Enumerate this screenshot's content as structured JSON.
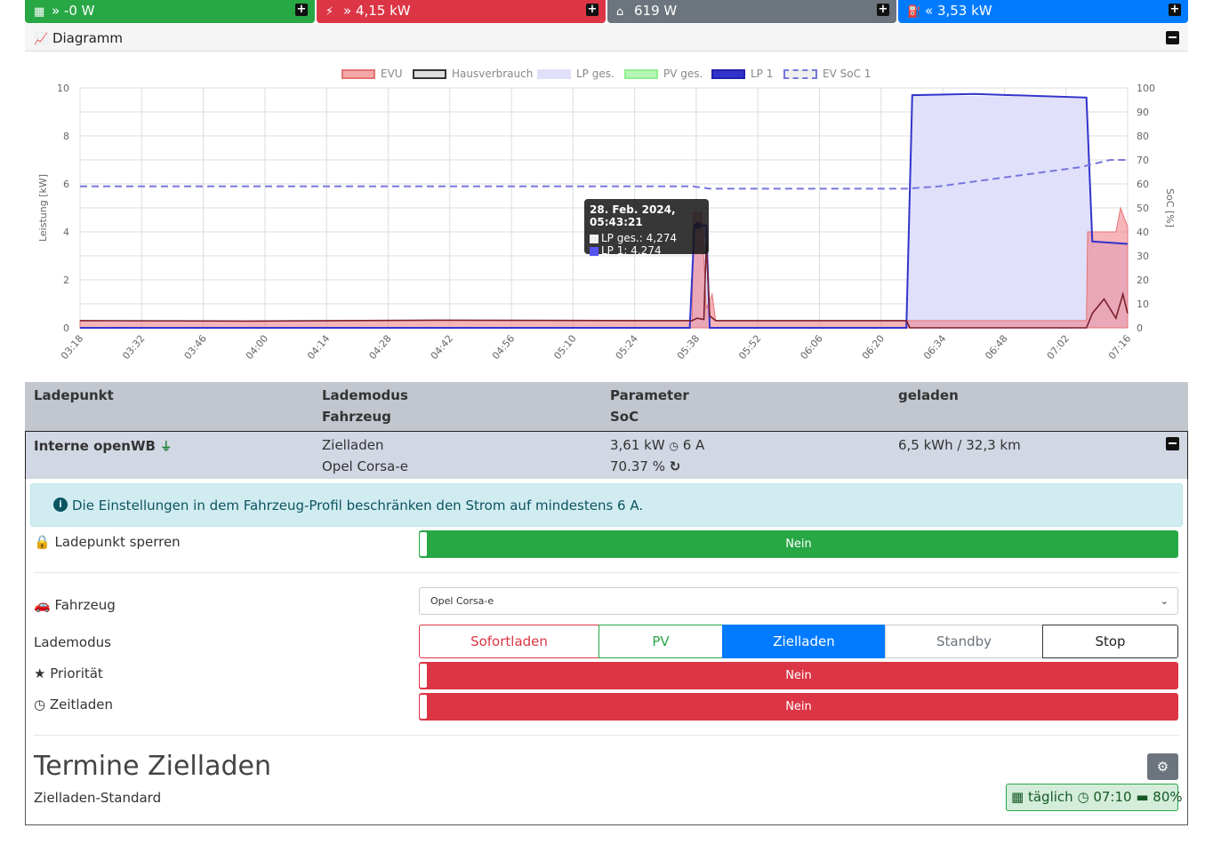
{
  "top_bar": [
    {
      "label": "-0 W",
      "color": "#28a745",
      "icon": "grid-meter-icon",
      "arrow": "»"
    },
    {
      "label": "4,15 kW",
      "color": "#dc3545",
      "icon": "power-tower-icon",
      "arrow": "»"
    },
    {
      "label": "619 W",
      "color": "#6c757d",
      "icon": "home-icon",
      "arrow": ""
    },
    {
      "label": "3,53 kW",
      "color": "#007bff",
      "icon": "charging-station-icon",
      "arrow": "«"
    }
  ],
  "diagram": {
    "title": "Diagramm"
  },
  "chart_data": {
    "type": "area",
    "legend": [
      "EVU",
      "Hausverbrauch",
      "LP ges.",
      "PV ges.",
      "LP 1",
      "EV SoC 1"
    ],
    "ylabel_left": "Leistung [kW]",
    "ylabel_right": "SoC [%]",
    "ylim_left": [
      0,
      10
    ],
    "ylim_right": [
      0,
      100
    ],
    "yticks_left": [
      "0",
      "2",
      "4",
      "6",
      "8",
      "10"
    ],
    "yticks_right": [
      "0",
      "10",
      "20",
      "30",
      "40",
      "50",
      "60",
      "70",
      "80",
      "90",
      "100"
    ],
    "xticks": [
      "03:18",
      "03:32",
      "03:46",
      "04:00",
      "04:14",
      "04:28",
      "04:42",
      "04:56",
      "05:10",
      "05:24",
      "05:38",
      "05:52",
      "06:06",
      "06:20",
      "06:34",
      "06:48",
      "07:02",
      "07:16"
    ],
    "series": [
      {
        "name": "EVU",
        "color": "#f4a6a8",
        "points": [
          [
            0,
            0.3
          ],
          [
            140,
            0.28
          ],
          [
            300,
            0.32
          ],
          [
            480,
            0.3
          ],
          [
            500,
            0.3
          ],
          [
            520,
            0.3
          ],
          [
            521,
            4.8
          ],
          [
            528,
            4.8
          ],
          [
            532,
            0.8
          ],
          [
            537,
            1.4
          ],
          [
            540,
            0.3
          ],
          [
            702,
            0.3
          ],
          [
            703,
            0.3
          ],
          [
            855,
            0.3
          ],
          [
            856,
            4.0
          ],
          [
            880,
            4.0
          ],
          [
            884,
            5.0
          ],
          [
            890,
            4.2
          ]
        ]
      },
      {
        "name": "Hausverbrauch",
        "color": "#7a1f2b",
        "points": [
          [
            0,
            0.3
          ],
          [
            140,
            0.28
          ],
          [
            300,
            0.32
          ],
          [
            480,
            0.3
          ],
          [
            520,
            0.3
          ],
          [
            524,
            0.4
          ],
          [
            530,
            0.35
          ],
          [
            532,
            3.5
          ],
          [
            535,
            0.5
          ],
          [
            540,
            0.3
          ],
          [
            702,
            0.3
          ],
          [
            705,
            0.0
          ],
          [
            855,
            0.0
          ],
          [
            860,
            0.6
          ],
          [
            870,
            1.2
          ],
          [
            880,
            0.4
          ],
          [
            886,
            1.4
          ],
          [
            890,
            0.6
          ]
        ]
      },
      {
        "name": "LP ges.",
        "color": "#e0e0fa",
        "points": [
          [
            0,
            0
          ],
          [
            518,
            0
          ],
          [
            522,
            4.27
          ],
          [
            532,
            4.27
          ],
          [
            535,
            0.0
          ],
          [
            702,
            0
          ],
          [
            707,
            9.7
          ],
          [
            855,
            9.6
          ],
          [
            860,
            3.6
          ],
          [
            890,
            3.5
          ]
        ]
      },
      {
        "name": "LP 1",
        "color": "#3333cc",
        "points": [
          [
            0,
            0
          ],
          [
            518,
            0
          ],
          [
            522,
            4.27
          ],
          [
            532,
            4.27
          ],
          [
            535,
            0.0
          ],
          [
            702,
            0
          ],
          [
            707,
            9.7
          ],
          [
            760,
            9.75
          ],
          [
            855,
            9.6
          ],
          [
            860,
            3.6
          ],
          [
            890,
            3.5
          ]
        ]
      },
      {
        "name": "EV SoC 1",
        "color": "#7777dd",
        "axis": "right",
        "points": [
          [
            0,
            59
          ],
          [
            520,
            59
          ],
          [
            535,
            58
          ],
          [
            702,
            58
          ],
          [
            730,
            59
          ],
          [
            760,
            61
          ],
          [
            790,
            63
          ],
          [
            820,
            65
          ],
          [
            850,
            67
          ],
          [
            875,
            70
          ],
          [
            890,
            70
          ]
        ]
      }
    ],
    "tooltip": {
      "title": "28. Feb. 2024, 05:43:21",
      "lines": [
        "LP ges.: 4,274",
        "LP 1: 4,274"
      ]
    }
  },
  "table": {
    "headers": {
      "col1": "Ladepunkt",
      "col2a": "Lademodus",
      "col2b": "Fahrzeug",
      "col3a": "Parameter",
      "col3b": "SoC",
      "col4": "geladen"
    },
    "row": {
      "name": "Interne openWB",
      "mode": "Zielladen",
      "vehicle": "Opel Corsa-e",
      "power": "3,61 kW",
      "current": "6 A",
      "soc": "70.37 %",
      "charged": "6,5 kWh / 32,3 km"
    }
  },
  "alert": "Die Einstellungen in dem Fahrzeug-Profil beschränken den Strom auf mindestens 6 A.",
  "settings": {
    "lock_label": "Ladepunkt sperren",
    "lock_value": "Nein",
    "vehicle_label": "Fahrzeug",
    "vehicle_value": "Opel Corsa-e",
    "mode_label": "Lademodus",
    "modes": [
      "Sofortladen",
      "PV",
      "Zielladen",
      "Standby",
      "Stop"
    ],
    "priority_label": "Priorität",
    "priority_value": "Nein",
    "timed_label": "Zeitladen",
    "timed_value": "Nein"
  },
  "schedule": {
    "title": "Termine Zielladen",
    "name": "Zielladen-Standard",
    "freq": "täglich",
    "time": "07:10",
    "soc": "80%"
  }
}
